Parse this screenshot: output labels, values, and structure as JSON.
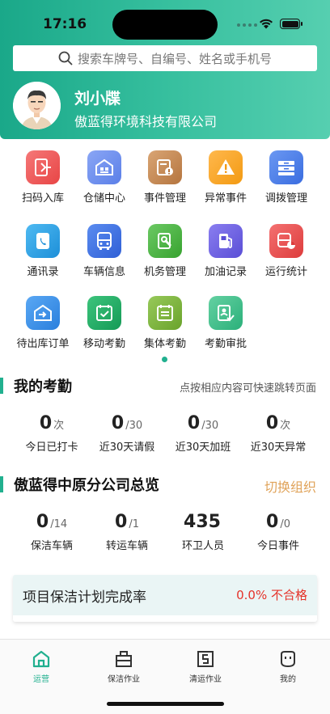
{
  "status": {
    "time": "17:16"
  },
  "search": {
    "placeholder": "搜索车牌号、自编号、姓名或手机号"
  },
  "user": {
    "name": "刘小牒",
    "company": "傲蓝得环境科技有限公司"
  },
  "functions": [
    {
      "label": "扫码入库",
      "icon": "scan-in-icon",
      "color": "#ef5a5a"
    },
    {
      "label": "仓储中心",
      "icon": "warehouse-icon",
      "color": "#6c8ef0"
    },
    {
      "label": "事件管理",
      "icon": "event-manage-icon",
      "color": "#c68a55"
    },
    {
      "label": "异常事件",
      "icon": "warning-icon",
      "color": "#f5a623"
    },
    {
      "label": "调拨管理",
      "icon": "transfer-icon",
      "color": "#4b7de8"
    },
    {
      "label": "通讯录",
      "icon": "phone-book-icon",
      "color": "#2da3e8"
    },
    {
      "label": "车辆信息",
      "icon": "bus-icon",
      "color": "#3a6fe0"
    },
    {
      "label": "机务管理",
      "icon": "maintenance-icon",
      "color": "#4fb84a"
    },
    {
      "label": "加油记录",
      "icon": "fuel-icon",
      "color": "#6e62e0"
    },
    {
      "label": "运行统计",
      "icon": "bus-stats-icon",
      "color": "#e84d4d"
    },
    {
      "label": "待出库订单",
      "icon": "outbound-order-icon",
      "color": "#3a8ee8"
    },
    {
      "label": "移动考勤",
      "icon": "mobile-attendance-icon",
      "color": "#27b06a"
    },
    {
      "label": "集体考勤",
      "icon": "group-attendance-icon",
      "color": "#7cb83c"
    },
    {
      "label": "考勤审批",
      "icon": "attendance-approval-icon",
      "color": "#3fbf8a"
    }
  ],
  "attendance": {
    "title": "我的考勤",
    "hint": "点按相应内容可快速跳转页面",
    "stats": [
      {
        "value": "0",
        "unit": "次",
        "label": "今日已打卡"
      },
      {
        "value": "0",
        "unit": "/30",
        "label": "近30天请假"
      },
      {
        "value": "0",
        "unit": "/30",
        "label": "近30天加班"
      },
      {
        "value": "0",
        "unit": "次",
        "label": "近30天异常"
      }
    ]
  },
  "overview": {
    "title": "傲蓝得中原分公司总览",
    "switch_label": "切换组织",
    "stats": [
      {
        "value": "0",
        "unit": "/14",
        "label": "保洁车辆"
      },
      {
        "value": "0",
        "unit": "/1",
        "label": "转运车辆"
      },
      {
        "value": "435",
        "unit": "",
        "label": "环卫人员"
      },
      {
        "value": "0",
        "unit": "/0",
        "label": "今日事件"
      }
    ]
  },
  "plan": {
    "title": "项目保洁计划完成率",
    "value": "0.0% 不合格"
  },
  "tabs": [
    {
      "label": "运营",
      "icon": "operation-home-icon",
      "active": true
    },
    {
      "label": "保洁作业",
      "icon": "cleaning-work-icon",
      "active": false
    },
    {
      "label": "清运作业",
      "icon": "transport-work-icon",
      "active": false
    },
    {
      "label": "我的",
      "icon": "profile-face-icon",
      "active": false
    }
  ],
  "colors": {
    "accent": "#21b08f",
    "warning": "#e0a35a",
    "danger": "#e5332a"
  }
}
